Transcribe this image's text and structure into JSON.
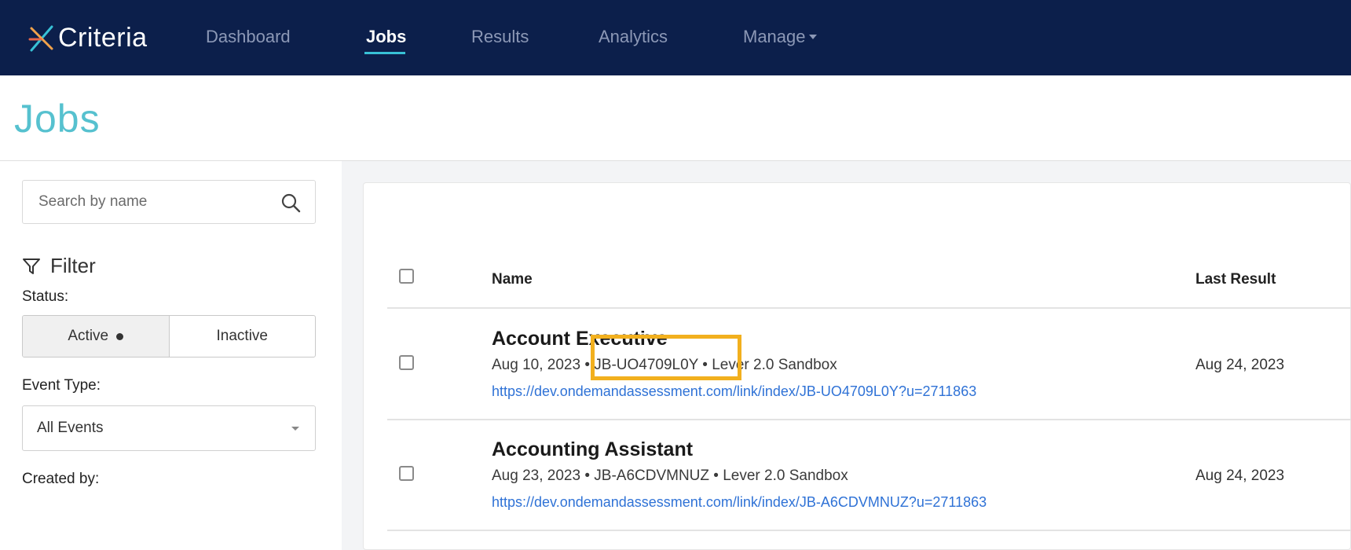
{
  "app": {
    "logo_text": "Criteria",
    "logo_colors": [
      "#f2a24a",
      "#e5654a",
      "#38c1d6"
    ]
  },
  "nav": {
    "items": [
      {
        "label": "Dashboard",
        "active": false
      },
      {
        "label": "Jobs",
        "active": true
      },
      {
        "label": "Results",
        "active": false
      },
      {
        "label": "Analytics",
        "active": false
      },
      {
        "label": "Manage",
        "active": false,
        "has_dropdown": true
      }
    ]
  },
  "page": {
    "title": "Jobs"
  },
  "sidebar": {
    "search": {
      "placeholder": "Search by name",
      "value": "",
      "icon": "search-icon"
    },
    "filter_label": "Filter",
    "filter_icon": "filter-icon",
    "status": {
      "label": "Status:",
      "options": [
        {
          "label": "Active",
          "selected": true
        },
        {
          "label": "Inactive",
          "selected": false
        }
      ]
    },
    "event_type": {
      "label": "Event Type:",
      "selected": "All Events"
    },
    "created_by": {
      "label": "Created by:"
    }
  },
  "table": {
    "columns": {
      "name": "Name",
      "last_result": "Last Result"
    },
    "rows": [
      {
        "name": "Account Executive",
        "date": "Aug 10, 2023",
        "job_id": "JB-UO4709L0Y",
        "source": "Lever 2.0 Sandbox",
        "link": "https://dev.ondemandassessment.com/link/index/JB-UO4709L0Y?u=2711863",
        "last_result": "Aug 24, 2023",
        "highlighted": true
      },
      {
        "name": "Accounting Assistant",
        "date": "Aug 23, 2023",
        "job_id": "JB-A6CDVMNUZ",
        "source": "Lever 2.0 Sandbox",
        "link": "https://dev.ondemandassessment.com/link/index/JB-A6CDVMNUZ?u=2711863",
        "last_result": "Aug 24, 2023",
        "highlighted": false
      }
    ],
    "separator": "•"
  },
  "colors": {
    "nav_bg": "#0c1f4b",
    "title_accent": "#56c1cf",
    "link": "#2f72d6",
    "highlight": "#f2b01e"
  }
}
